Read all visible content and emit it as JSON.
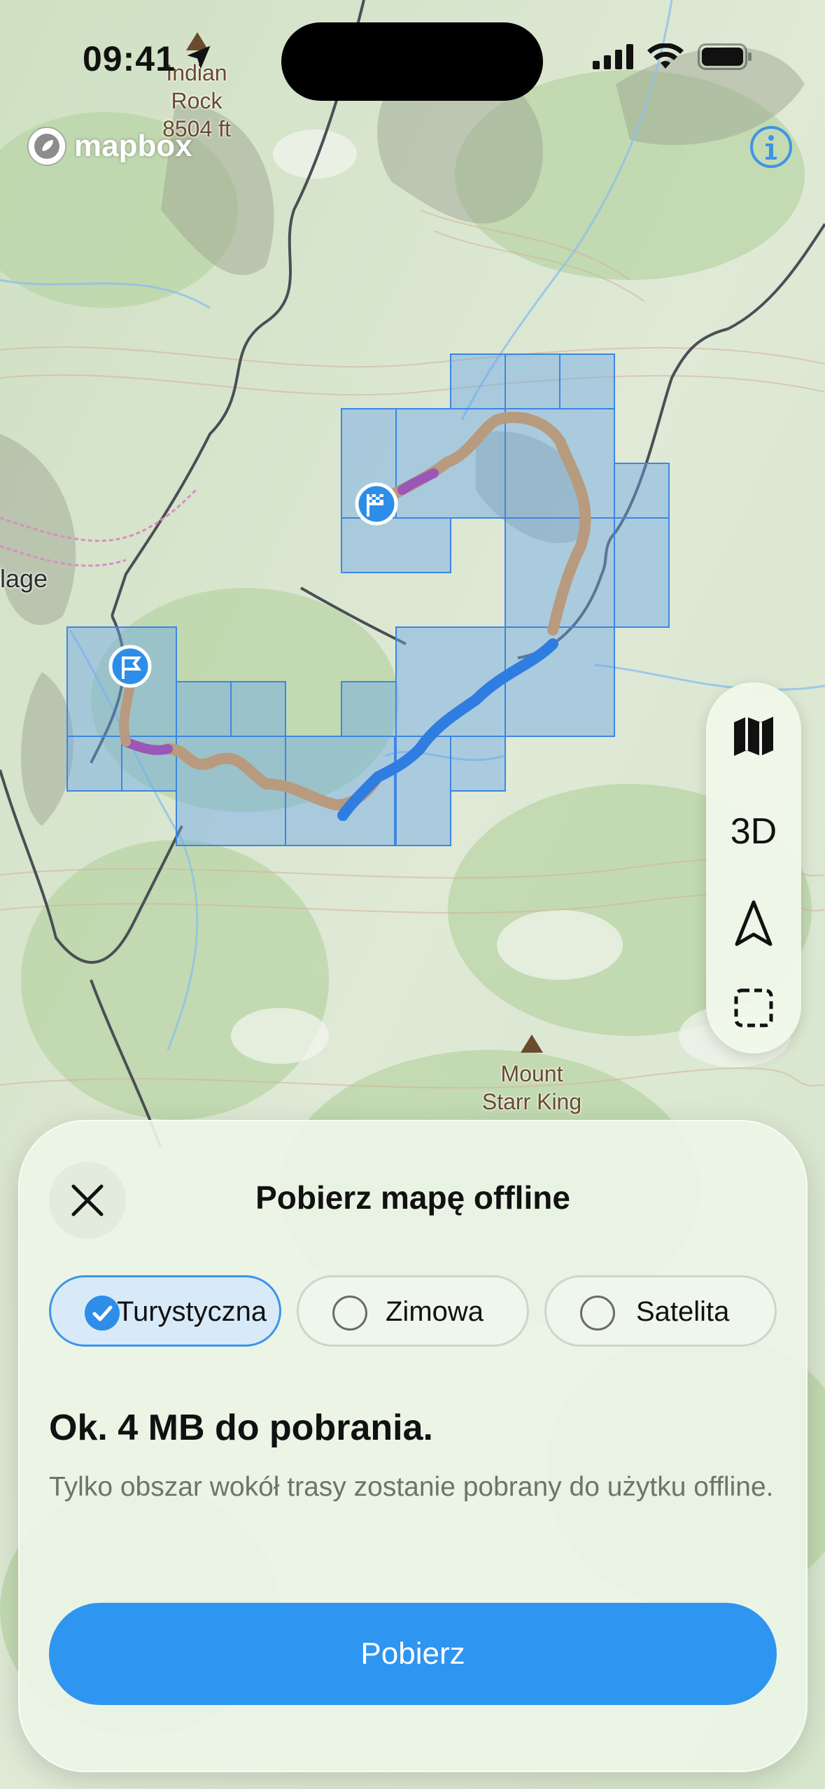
{
  "status_bar": {
    "time": "09:41"
  },
  "map": {
    "logo_text": "mapbox",
    "peaks": [
      {
        "name_line1": "Indian",
        "name_line2": "Rock",
        "elevation": "8504 ft"
      },
      {
        "name_line1": "Mount",
        "name_line2": "Starr King"
      }
    ],
    "place_label": "lage"
  },
  "map_controls": {
    "three_d_label": "3D"
  },
  "sheet": {
    "title": "Pobierz mapę offline",
    "options": [
      {
        "label": "Turystyczna",
        "selected": true
      },
      {
        "label": "Zimowa",
        "selected": false
      },
      {
        "label": "Satelita",
        "selected": false
      }
    ],
    "size_heading": "Ok. 4 MB do pobrania.",
    "description": "Tylko obszar wokół trasy zostanie pobrany do użytku offline.",
    "download_label": "Pobierz"
  },
  "colors": {
    "accent": "#2e95f1",
    "route_brown": "#b89a7e",
    "route_purple": "#9b57b6",
    "route_blue": "#2f7de0",
    "tile_fill": "#6aa6e8"
  }
}
